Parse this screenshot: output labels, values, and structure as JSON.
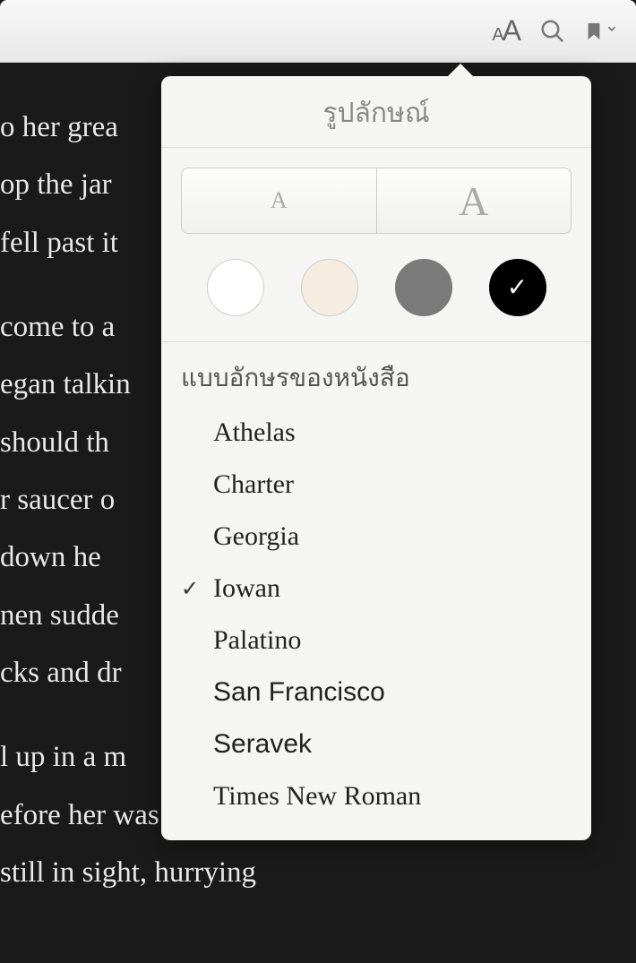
{
  "toolbar": {
    "icons": {
      "font_small": "A",
      "font_large": "A"
    }
  },
  "content": {
    "para1_line1": "o her grea",
    "para1_line2": "op the jar",
    "para1_line3": "fell past it",
    "para2_line1": "come to a",
    "para2_line2": "egan talkin",
    "para2_line3": " should th",
    "para2_line4": "r saucer o",
    "para2_line5": " down he",
    "para2_line6": "nen sudde",
    "para2_line7": "cks and dr",
    "para3_line1": "l up in a m",
    "para3_line2": "efore her was another",
    "para3_line3": "still in sight, hurrying"
  },
  "popover": {
    "title": "รูปลักษณ์",
    "size_small_label": "A",
    "size_large_label": "A",
    "themes": [
      {
        "name": "white",
        "selected": false
      },
      {
        "name": "sepia",
        "selected": false
      },
      {
        "name": "gray",
        "selected": false
      },
      {
        "name": "black",
        "selected": true
      }
    ],
    "font_section_label": "แบบอักษรของหนังสือ",
    "fonts": [
      {
        "name": "Athelas",
        "selected": false,
        "class": "font-athelas"
      },
      {
        "name": "Charter",
        "selected": false,
        "class": "font-charter"
      },
      {
        "name": "Georgia",
        "selected": false,
        "class": "font-georgia"
      },
      {
        "name": "Iowan",
        "selected": true,
        "class": "font-iowan"
      },
      {
        "name": "Palatino",
        "selected": false,
        "class": "font-palatino"
      },
      {
        "name": "San Francisco",
        "selected": false,
        "class": "font-sanfrancisco"
      },
      {
        "name": "Seravek",
        "selected": false,
        "class": "font-seravek"
      },
      {
        "name": "Times New Roman",
        "selected": false,
        "class": "font-times"
      }
    ],
    "check_mark": "✓"
  }
}
